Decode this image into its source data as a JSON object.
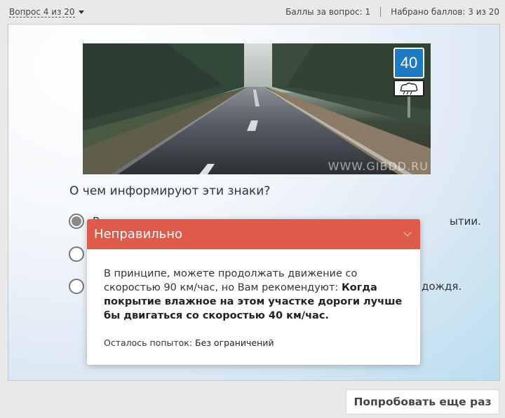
{
  "header": {
    "question_selector": "Вопрос 4 из 20",
    "points_per_question": "Баллы за вопрос: 1",
    "points_scored": "Набрано баллов: 3 из 20"
  },
  "image": {
    "watermark": "WWW.GIBDD.RU",
    "sign_speed_value": "40"
  },
  "question": {
    "text": "О чем информируют эти знаки?",
    "options": [
      {
        "label": "В",
        "tail": "ытии.",
        "selected": true
      },
      {
        "label": "",
        "tail": "",
        "selected": false
      },
      {
        "label": "",
        "tail": "дождя.",
        "selected": false
      }
    ]
  },
  "feedback": {
    "title": "Неправильно",
    "message_plain": "В принципе, можете продолжать движение со скоростью 90 км/час, но Вам рекомендуют: ",
    "message_bold": "Когда покрытие влажное на этом участке дороги лучше бы двигаться со скоростью 40 км/час.",
    "attempts_label": "Осталось попыток: ",
    "attempts_value": "Без ограничений"
  },
  "actions": {
    "retry_label": "Попробовать еще раз"
  },
  "colors": {
    "feedback_header": "#de5a4b",
    "sign_blue": "#1f7bc1"
  }
}
